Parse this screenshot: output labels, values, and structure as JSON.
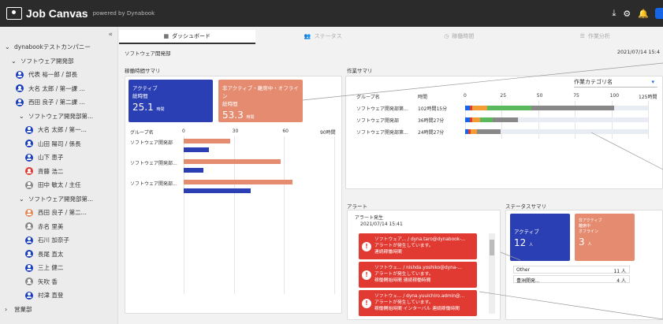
{
  "app": {
    "name": "Job Canvas",
    "powered": "powered by Dynabook"
  },
  "top_icons": [
    "download-icon",
    "gear-icon",
    "bell-icon",
    "user-icon"
  ],
  "sidebar": {
    "collapse": "«",
    "items": [
      {
        "label": "dynabookテストカンパニー",
        "caret": "⌄",
        "type": "group",
        "color": ""
      },
      {
        "label": "ソフトウェア開発部",
        "caret": "⌄",
        "type": "group",
        "color": ""
      },
      {
        "label": "代表 裕一郎 / 部長",
        "type": "person",
        "color": "#1a3fbd"
      },
      {
        "label": "大名 太郎 / 第一課 ...",
        "type": "person",
        "color": "#1a3fbd"
      },
      {
        "label": "西田 良子 / 第二課 ...",
        "type": "person",
        "color": "#1a3fbd"
      },
      {
        "label": "ソフトウェア開発部第...",
        "caret": "⌄",
        "type": "group",
        "color": ""
      },
      {
        "label": "大名 太郎 / 第一...",
        "type": "person",
        "color": "#1a3fbd"
      },
      {
        "label": "山田 陽司 / 係長",
        "type": "person",
        "color": "#1a3fbd"
      },
      {
        "label": "山下 恵子",
        "type": "person",
        "color": "#1a3fbd"
      },
      {
        "label": "斉藤 浩二",
        "type": "person",
        "color": "#e03a33"
      },
      {
        "label": "田中 敏太 / 主任",
        "type": "person",
        "color": "#888888"
      },
      {
        "label": "ソフトウェア開発部第...",
        "caret": "⌄",
        "type": "group",
        "color": ""
      },
      {
        "label": "西田 良子 / 第二...",
        "type": "person",
        "color": "#e58b5a"
      },
      {
        "label": "赤名 里美",
        "type": "person",
        "color": "#888888"
      },
      {
        "label": "石川 加奈子",
        "type": "person",
        "color": "#1a3fbd"
      },
      {
        "label": "長尾 直太",
        "type": "person",
        "color": "#1a3fbd"
      },
      {
        "label": "三上 健二",
        "type": "person",
        "color": "#1a3fbd"
      },
      {
        "label": "矢吹 香",
        "type": "person",
        "color": "#888888"
      },
      {
        "label": "村津 直登",
        "type": "person",
        "color": "#1a3fbd"
      },
      {
        "label": "営業部",
        "caret": "›",
        "type": "group",
        "color": ""
      }
    ]
  },
  "tabs": [
    {
      "label": "ダッシュボード",
      "icon": "grid-icon",
      "active": true
    },
    {
      "label": "ステータス",
      "icon": "people-icon",
      "active": false
    },
    {
      "label": "稼働時間",
      "icon": "clock-icon",
      "active": false
    },
    {
      "label": "作業分析",
      "icon": "list-icon",
      "active": false
    }
  ],
  "main": {
    "title": "ソフトウェア開発部",
    "date": "2021/07/14 15:4"
  },
  "hours_summary": {
    "title": "稼働時間サマリ",
    "cards": [
      {
        "title": "アクティブ",
        "sub": "総時間",
        "value": "25.1",
        "unit": "時間",
        "color": "#2a3fb4"
      },
      {
        "title": "非アクティブ・離席中・オフライン",
        "sub": "総時間",
        "value": "53.3",
        "unit": "時間",
        "color": "#e58b70"
      }
    ],
    "chart": {
      "group_header": "グループ名",
      "ticks": [
        "0",
        "30",
        "60",
        "90時間"
      ],
      "rows": [
        {
          "label": "ソフトウェア開発部",
          "inactive": 28,
          "active": 15
        },
        {
          "label": "ソフトウェア開発部...",
          "inactive": 58,
          "active": 12
        },
        {
          "label": "ソフトウェア開発部...",
          "inactive": 65,
          "active": 40
        }
      ],
      "max": 90
    }
  },
  "work_summary": {
    "title": "作業サマリ",
    "dropdown": "作業カテゴリ名",
    "headers": {
      "group": "グループ名",
      "time": "時間"
    },
    "ticks": [
      "0",
      "25",
      "50",
      "75",
      "100",
      "125時間"
    ],
    "rows": [
      {
        "label": "ソフトウェア開発部第...",
        "time": "102時間15分",
        "total": 102,
        "segments": [
          {
            "v": 3,
            "c": "#1565e6"
          },
          {
            "v": 2,
            "c": "#e03a33"
          },
          {
            "v": 10,
            "c": "#f39c33"
          },
          {
            "v": 30,
            "c": "#5cb85c"
          },
          {
            "v": 57,
            "c": "#888888"
          }
        ]
      },
      {
        "label": "ソフトウェア開発部",
        "time": "36時間27分",
        "total": 36,
        "segments": [
          {
            "v": 3,
            "c": "#1565e6"
          },
          {
            "v": 2,
            "c": "#e03a33"
          },
          {
            "v": 5,
            "c": "#f39c33"
          },
          {
            "v": 9,
            "c": "#5cb85c"
          },
          {
            "v": 17,
            "c": "#888888"
          }
        ]
      },
      {
        "label": "ソフトウェア開発部第...",
        "time": "24時間27分",
        "total": 24,
        "segments": [
          {
            "v": 2,
            "c": "#1565e6"
          },
          {
            "v": 2,
            "c": "#e03a33"
          },
          {
            "v": 4,
            "c": "#f39c33"
          },
          {
            "v": 16,
            "c": "#888888"
          }
        ]
      }
    ],
    "max": 125
  },
  "alerts": {
    "title": "アラート",
    "header": "アラート発生",
    "time": "2021/07/14 15:41",
    "items": [
      {
        "line1": "ソフトウェア... / dyna.taro@dynabook-...",
        "line2": "アラートが発生しています。",
        "line3": "連続稼働時間"
      },
      {
        "line1": "ソフトウェ... / nishda.yoshiko@dyna-...",
        "line2": "アラートが発生しています。",
        "line3": "稼働開始時間 連続稼働時間"
      },
      {
        "line1": "ソフトウェ... / dyna.yuuichiro.admin@...",
        "line2": "アラートが発生しています。",
        "line3": "稼働開始時間 インターバル 連続稼働時間"
      }
    ]
  },
  "status_summary": {
    "title": "ステータスサマリ",
    "cards": [
      {
        "title": "アクティブ",
        "value": "12",
        "unit": "人",
        "color": "#2a3fb4"
      },
      {
        "title": "非アクティブ",
        "title2": "離席中",
        "title3": "オフライン",
        "value": "3",
        "unit": "人",
        "color": "#e58b70"
      }
    ],
    "rows": [
      {
        "label": "Other",
        "value": "11 人"
      },
      {
        "label": "豊洲開発...",
        "value": "4 人"
      }
    ]
  }
}
